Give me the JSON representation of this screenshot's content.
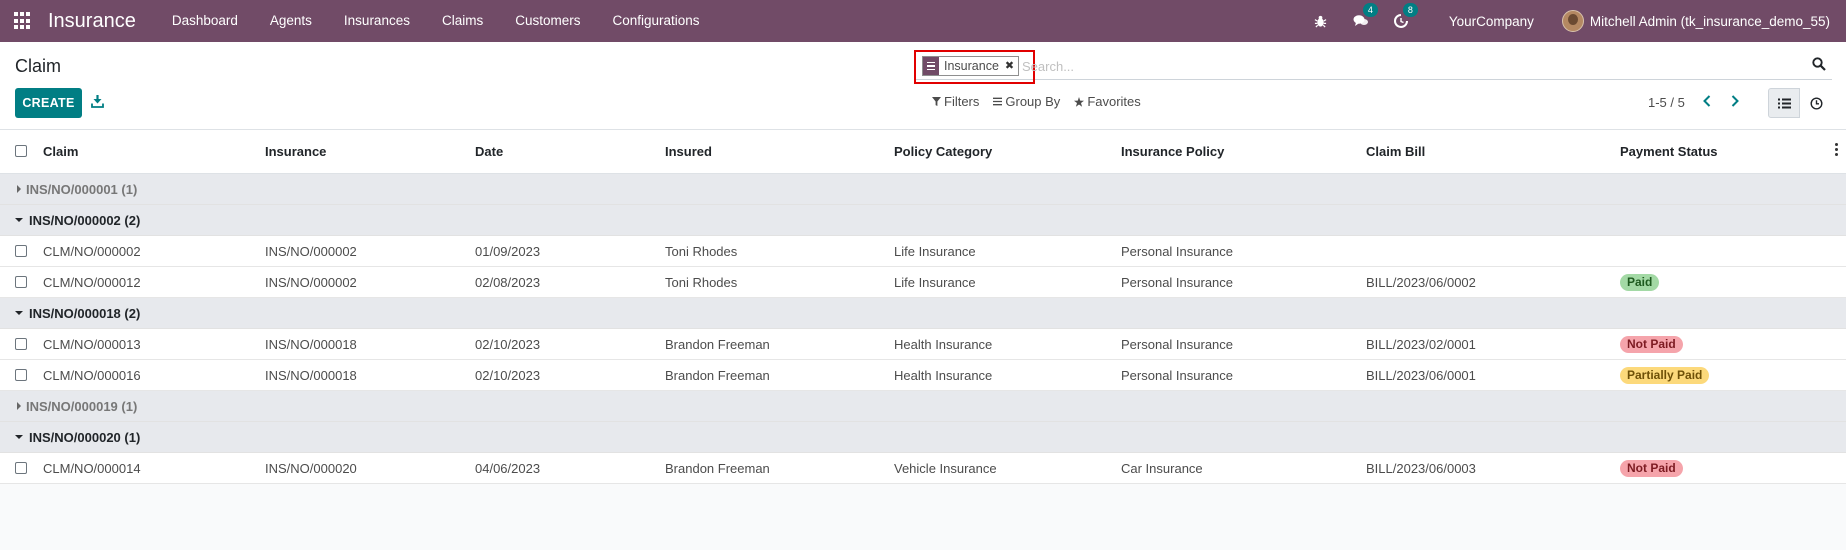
{
  "navbar": {
    "brand": "Insurance",
    "menu": [
      "Dashboard",
      "Agents",
      "Insurances",
      "Claims",
      "Customers",
      "Configurations"
    ],
    "chat_count": "4",
    "activity_count": "8",
    "company": "YourCompany",
    "user": "Mitchell Admin (tk_insurance_demo_55)",
    "bar_color": "#714b67"
  },
  "control": {
    "breadcrumb": "Claim",
    "create_label": "CREATE",
    "facet_label": "Insurance",
    "search_placeholder": "Search...",
    "filters_label": "Filters",
    "groupby_label": "Group By",
    "favorites_label": "Favorites",
    "pager": "1-5 / 5",
    "accent_color": "#017e84"
  },
  "table": {
    "headers": [
      "Claim",
      "Insurance",
      "Date",
      "Insured",
      "Policy Category",
      "Insurance Policy",
      "Claim Bill",
      "Payment Status"
    ],
    "groups": [
      {
        "label": "INS/NO/000001 (1)",
        "expanded": false,
        "rows": []
      },
      {
        "label": "INS/NO/000002 (2)",
        "expanded": true,
        "rows": [
          {
            "claim": "CLM/NO/000002",
            "insurance": "INS/NO/000002",
            "date": "01/09/2023",
            "insured": "Toni Rhodes",
            "category": "Life Insurance",
            "policy": "Personal Insurance",
            "bill": "",
            "status": "",
            "status_type": ""
          },
          {
            "claim": "CLM/NO/000012",
            "insurance": "INS/NO/000002",
            "date": "02/08/2023",
            "insured": "Toni Rhodes",
            "category": "Life Insurance",
            "policy": "Personal Insurance",
            "bill": "BILL/2023/06/0002",
            "status": "Paid",
            "status_type": "paid"
          }
        ]
      },
      {
        "label": "INS/NO/000018 (2)",
        "expanded": true,
        "rows": [
          {
            "claim": "CLM/NO/000013",
            "insurance": "INS/NO/000018",
            "date": "02/10/2023",
            "insured": "Brandon Freeman",
            "category": "Health Insurance",
            "policy": "Personal Insurance",
            "bill": "BILL/2023/02/0001",
            "status": "Not Paid",
            "status_type": "notpaid"
          },
          {
            "claim": "CLM/NO/000016",
            "insurance": "INS/NO/000018",
            "date": "02/10/2023",
            "insured": "Brandon Freeman",
            "category": "Health Insurance",
            "policy": "Personal Insurance",
            "bill": "BILL/2023/06/0001",
            "status": "Partially Paid",
            "status_type": "partial"
          }
        ]
      },
      {
        "label": "INS/NO/000019 (1)",
        "expanded": false,
        "rows": []
      },
      {
        "label": "INS/NO/000020 (1)",
        "expanded": true,
        "rows": [
          {
            "claim": "CLM/NO/000014",
            "insurance": "INS/NO/000020",
            "date": "04/06/2023",
            "insured": "Brandon Freeman",
            "category": "Vehicle Insurance",
            "policy": "Car Insurance",
            "bill": "BILL/2023/06/0003",
            "status": "Not Paid",
            "status_type": "notpaid"
          }
        ]
      }
    ]
  }
}
